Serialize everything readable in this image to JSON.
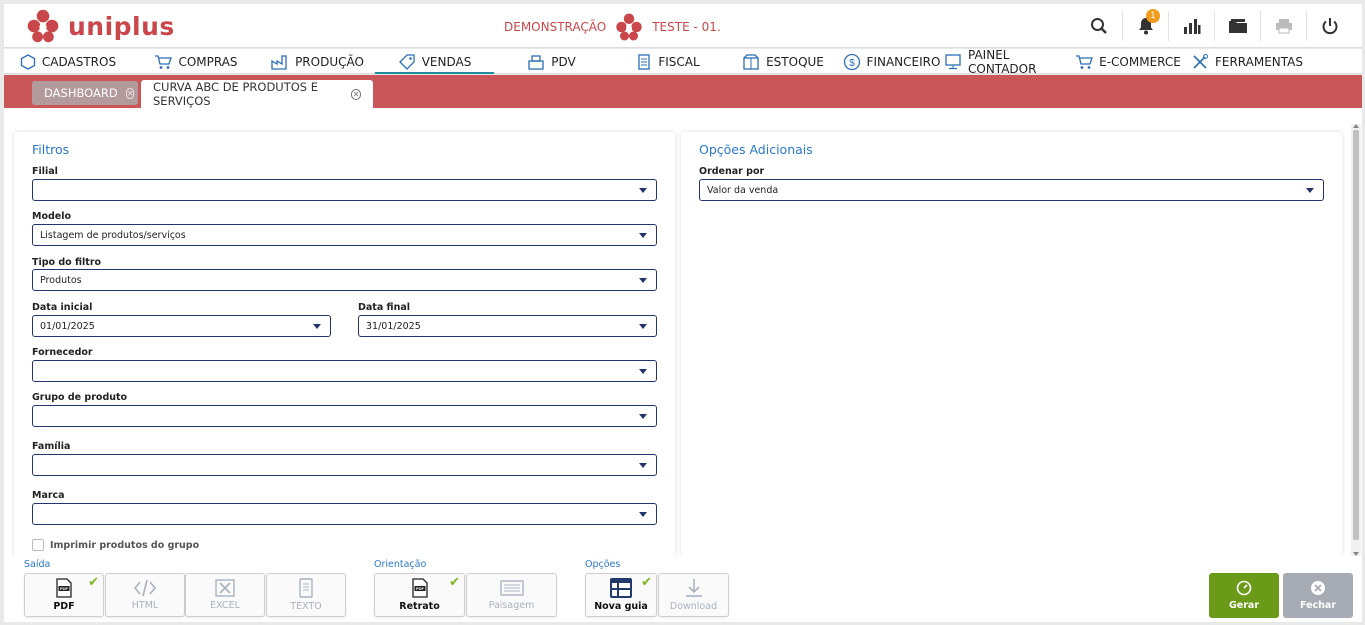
{
  "header": {
    "brand": "uniplus",
    "environment": "DEMONSTRAÇÃO",
    "company": "TESTE - 01.",
    "notification_count": "1"
  },
  "menu": [
    {
      "label": "CADASTROS",
      "icon": "hexagon-icon"
    },
    {
      "label": "COMPRAS",
      "icon": "cart-icon"
    },
    {
      "label": "PRODUÇÃO",
      "icon": "factory-icon"
    },
    {
      "label": "VENDAS",
      "icon": "tag-icon"
    },
    {
      "label": "PDV",
      "icon": "register-icon"
    },
    {
      "label": "FISCAL",
      "icon": "document-icon"
    },
    {
      "label": "ESTOQUE",
      "icon": "box-icon"
    },
    {
      "label": "FINANCEIRO",
      "icon": "dollar-icon"
    },
    {
      "label": "PAINEL CONTADOR",
      "icon": "monitor-icon"
    },
    {
      "label": "E-COMMERCE",
      "icon": "cart-icon"
    },
    {
      "label": "FERRAMENTAS",
      "icon": "tools-icon"
    }
  ],
  "tabs": [
    {
      "label": "DASHBOARD"
    },
    {
      "label": "CURVA ABC DE PRODUTOS E SERVIÇOS"
    }
  ],
  "filtros": {
    "title": "Filtros",
    "filial": {
      "label": "Filial",
      "value": ""
    },
    "modelo": {
      "label": "Modelo",
      "value": "Listagem de produtos/serviços"
    },
    "tipo_filtro": {
      "label": "Tipo do filtro",
      "value": "Produtos"
    },
    "data_inicial": {
      "label": "Data inicial",
      "value": "01/01/2025"
    },
    "data_final": {
      "label": "Data final",
      "value": "31/01/2025"
    },
    "fornecedor": {
      "label": "Fornecedor",
      "value": ""
    },
    "grupo": {
      "label": "Grupo de produto",
      "value": ""
    },
    "familia": {
      "label": "Família",
      "value": ""
    },
    "marca": {
      "label": "Marca",
      "value": ""
    },
    "imprimir_grupo": {
      "label": "Imprimir produtos do grupo",
      "checked": false
    }
  },
  "opcoes": {
    "title": "Opções Adicionais",
    "ordenar": {
      "label": "Ordenar por",
      "value": "Valor da venda"
    }
  },
  "toolbar": {
    "saida": {
      "label": "Saída",
      "pdf": "PDF",
      "html": "HTML",
      "excel": "EXCEL",
      "texto": "TEXTO"
    },
    "orientacao": {
      "label": "Orientação",
      "retrato": "Retrato",
      "paisagem": "Paisagem"
    },
    "opcoes": {
      "label": "Opções",
      "nova_guia": "Nova guia",
      "download": "Download"
    },
    "gerar": "Gerar",
    "fechar": "Fechar"
  },
  "colors": {
    "brand": "#c9474a",
    "tab_band": "#c9575a",
    "accent": "#2a78c9",
    "gerar": "#6a9a18",
    "fechar": "#a7acb4"
  }
}
